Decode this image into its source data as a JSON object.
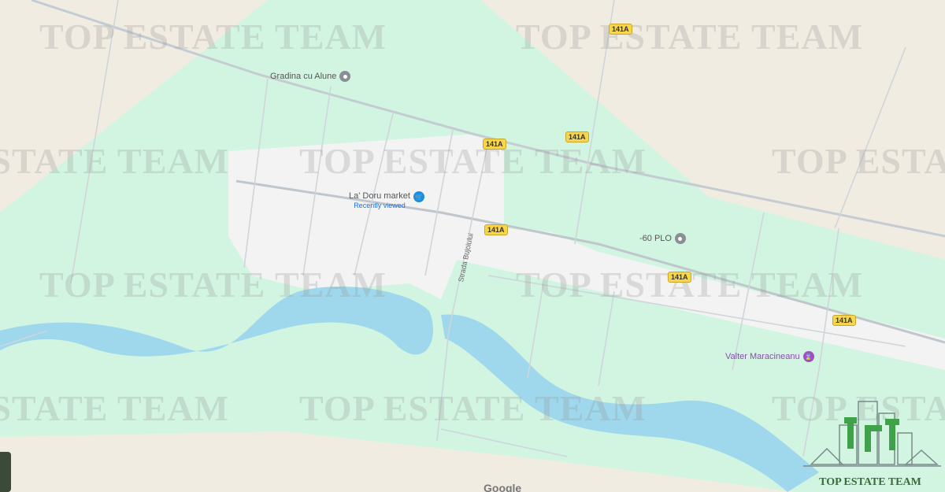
{
  "map": {
    "colors": {
      "land": "#f1ece2",
      "green": "#d2f5e2",
      "urban": "#f3f3f4",
      "water": "#9fd8ec",
      "road": "#bfc6cc"
    },
    "watermark": "TOP ESTATE TEAM",
    "road_shields": [
      "141A",
      "141A",
      "141A",
      "141A",
      "141A",
      "141A"
    ],
    "pois": [
      {
        "label": "Gradina cu Alune",
        "icon": "grey-place-pin-icon"
      },
      {
        "label": "La' Doru market",
        "sublabel": "Recently viewed",
        "icon": "shopping-cart-pin-icon"
      },
      {
        "label": "-60 PLO",
        "icon": "grey-place-pin-icon"
      },
      {
        "label": "Valter Maracineanu",
        "icon": "hourglass-pin-icon"
      }
    ],
    "street_label": "Strada Bujoiului",
    "attribution": "Google",
    "logo_text": "TOP ESTATE TEAM"
  }
}
